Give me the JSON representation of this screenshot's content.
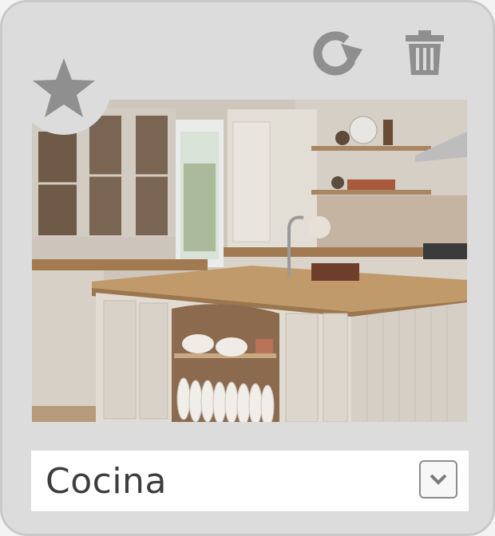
{
  "card": {
    "favorite_icon": "star-icon",
    "refresh_icon": "refresh-icon",
    "delete_icon": "trash-icon",
    "image_subject": "kitchen-photo",
    "room_select": {
      "selected": "Cocina",
      "arrow_icon": "chevron-down-icon"
    }
  },
  "colors": {
    "card_bg": "#dcdcdc",
    "icon_gray": "#8f8f8f",
    "text": "#3d3d3d"
  }
}
